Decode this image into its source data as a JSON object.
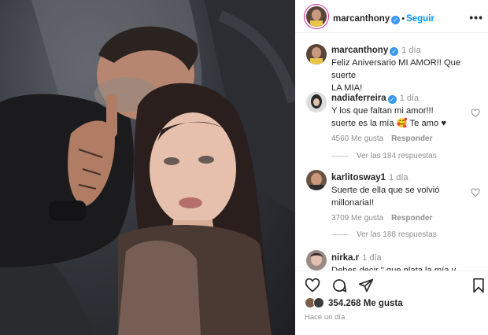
{
  "post": {
    "username": "marcanthony",
    "follow_label": "Seguir",
    "more_label": "•••",
    "caption": {
      "username": "marcanthony",
      "time": "1 día",
      "text_line1": "Feliz Aniversario MI AMOR!! Que suerte",
      "text_line2": "LA MIA!"
    }
  },
  "comments": [
    {
      "username": "nadiaferreira",
      "verified": true,
      "time": "1 día",
      "line1": "Y los que faltan mi amor!!!",
      "line2": "suerte es la mía 🥰 Te amo ♥",
      "likes": "4560 Me gusta",
      "reply_label": "Responder",
      "replies": "Ver las 184 respuestas"
    },
    {
      "username": "karlitosway1",
      "verified": false,
      "time": "1 día",
      "line1": "Suerte de ella que se volvió",
      "line2": "millonaria!!",
      "likes": "3709 Me gusta",
      "reply_label": "Responder",
      "replies": "Ver las 188 respuestas"
    },
    {
      "username": "nirka.r",
      "verified": false,
      "time": "1 día",
      "line1": "Debes decir \" que plata la mía y"
    }
  ],
  "footer": {
    "likes": "354.268 Me gusta",
    "ago": "Hace un día"
  },
  "icons": {
    "verified": "verified-check-icon",
    "like": "heart-icon",
    "comment": "comment-bubble-icon",
    "share": "paper-plane-icon",
    "save": "bookmark-icon"
  },
  "colors": {
    "follow": "#0095f6",
    "verified": "#3897f0",
    "muted": "#8e8e8e",
    "text": "#262626"
  }
}
